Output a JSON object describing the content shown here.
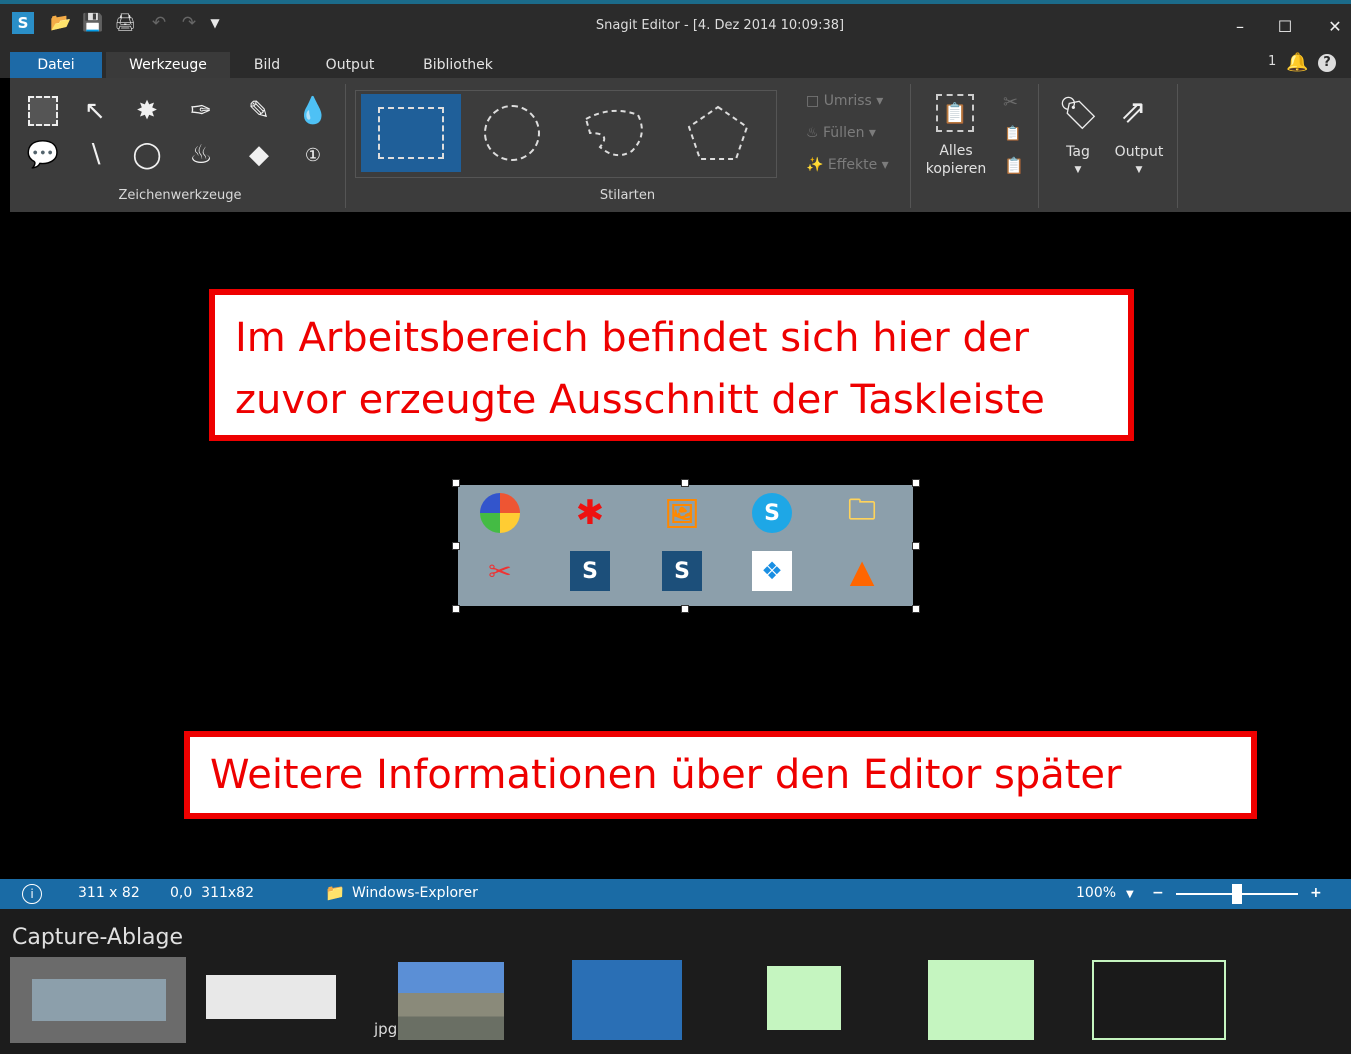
{
  "window": {
    "app_icon": "S",
    "title": "Snagit Editor - [4. Dez 2014 10:09:38]",
    "controls": {
      "minimize": "–",
      "maximize": "☐",
      "close": "✕"
    }
  },
  "quick_access": [
    "open-icon",
    "save-icon",
    "print-icon",
    "undo-icon",
    "redo-icon",
    "customize-icon"
  ],
  "tabs": [
    {
      "label": "Datei",
      "selected": false
    },
    {
      "label": "Werkzeuge",
      "selected": true
    },
    {
      "label": "Bild",
      "selected": false
    },
    {
      "label": "Output",
      "selected": false
    },
    {
      "label": "Bibliothek",
      "selected": false
    }
  ],
  "notifications": {
    "count": "1"
  },
  "ribbon": {
    "drawing_tools_label": "Zeichenwerkzeuge",
    "styles_label": "Stilarten",
    "outline_label": "Umriss",
    "fill_label": "Füllen",
    "effects_label": "Effekte",
    "copy_all_label_line1": "Alles",
    "copy_all_label_line2": "kopieren",
    "tag_label": "Tag",
    "output_label": "Output"
  },
  "canvas": {
    "callout1_line1": "Im Arbeitsbereich befindet sich hier der",
    "callout1_line2": "zuvor erzeugte Ausschnitt der Taskleiste",
    "callout2": "Weitere Informationen über den Editor später"
  },
  "statusbar": {
    "dimensions": "311 x 82",
    "selection": "0,0  311x82",
    "explorer_label": "Windows-Explorer",
    "zoom": "100%",
    "zoom_fraction": 0.5
  },
  "tray": {
    "title": "Capture-Ablage",
    "thumb3_format": "jpg"
  },
  "colors": {
    "accent": "#1d6aa7",
    "callout_border": "#e00000",
    "callout_text": "#e00000",
    "ribbon_bg": "#3c3c3c"
  }
}
